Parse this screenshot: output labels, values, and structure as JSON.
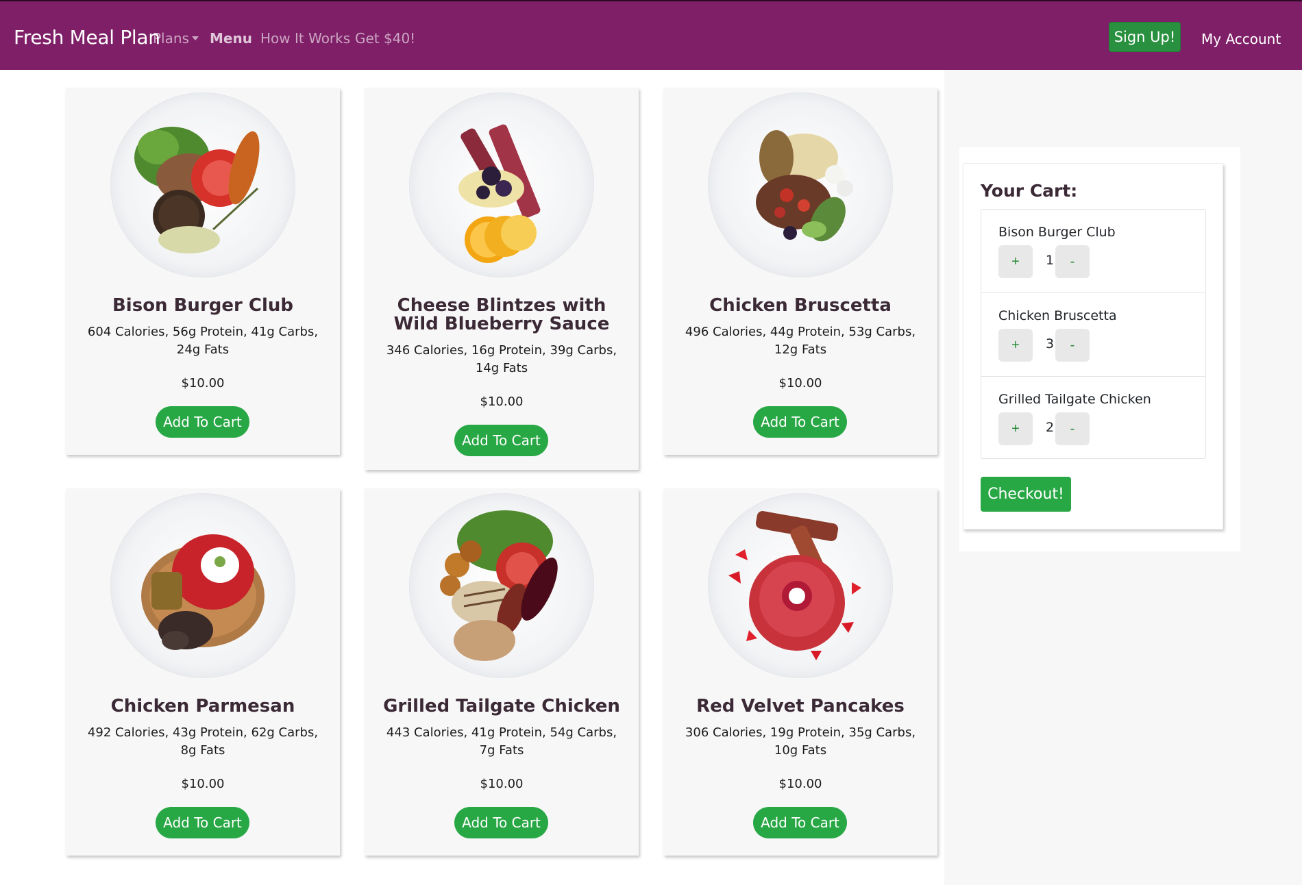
{
  "navbar": {
    "brand": "Fresh Meal Plan",
    "links": [
      "Plans",
      "Menu",
      "How It Works",
      "Get $40!"
    ],
    "signup": "Sign Up!",
    "account": "My Account"
  },
  "meals": [
    {
      "name": "Bison Burger Club",
      "nutrition": "604 Calories, 56g Protein, 41g Carbs, 24g Fats",
      "price": "$10.00",
      "button": "Add To Cart",
      "image": "bison-burger-plate"
    },
    {
      "name": "Cheese Blintzes with Wild Blueberry Sauce",
      "nutrition": "346 Calories, 16g Protein, 39g Carbs, 14g Fats",
      "price": "$10.00",
      "button": "Add To Cart",
      "image": "blintzes-plate"
    },
    {
      "name": "Chicken Bruscetta",
      "nutrition": "496 Calories, 44g Protein, 53g Carbs, 12g Fats",
      "price": "$10.00",
      "button": "Add To Cart",
      "image": "chicken-bruscetta-plate"
    },
    {
      "name": "Chicken Parmesan",
      "nutrition": "492 Calories, 43g Protein, 62g Carbs, 8g Fats",
      "price": "$10.00",
      "button": "Add To Cart",
      "image": "chicken-parmesan-plate"
    },
    {
      "name": "Grilled Tailgate Chicken",
      "nutrition": "443 Calories, 41g Protein, 54g Carbs, 7g Fats",
      "price": "$10.00",
      "button": "Add To Cart",
      "image": "grilled-chicken-plate"
    },
    {
      "name": "Red Velvet Pancakes",
      "nutrition": "306 Calories, 19g Protein, 35g Carbs, 10g Fats",
      "price": "$10.00",
      "button": "Add To Cart",
      "image": "pancakes-plate"
    }
  ],
  "cart": {
    "title": "Your Cart:",
    "items": [
      {
        "name": "Bison Burger Club",
        "qty": "1",
        "plus": "+",
        "minus": "-"
      },
      {
        "name": "Chicken Bruscetta",
        "qty": "3",
        "plus": "+",
        "minus": "-"
      },
      {
        "name": "Grilled Tailgate Chicken",
        "qty": "2",
        "plus": "+",
        "minus": "-"
      }
    ],
    "checkout": "Checkout!"
  },
  "colors": {
    "navbar": "#7f1f68",
    "accent_green": "#28a745",
    "signup_green": "#28903e",
    "title_text": "#3b2a36"
  }
}
